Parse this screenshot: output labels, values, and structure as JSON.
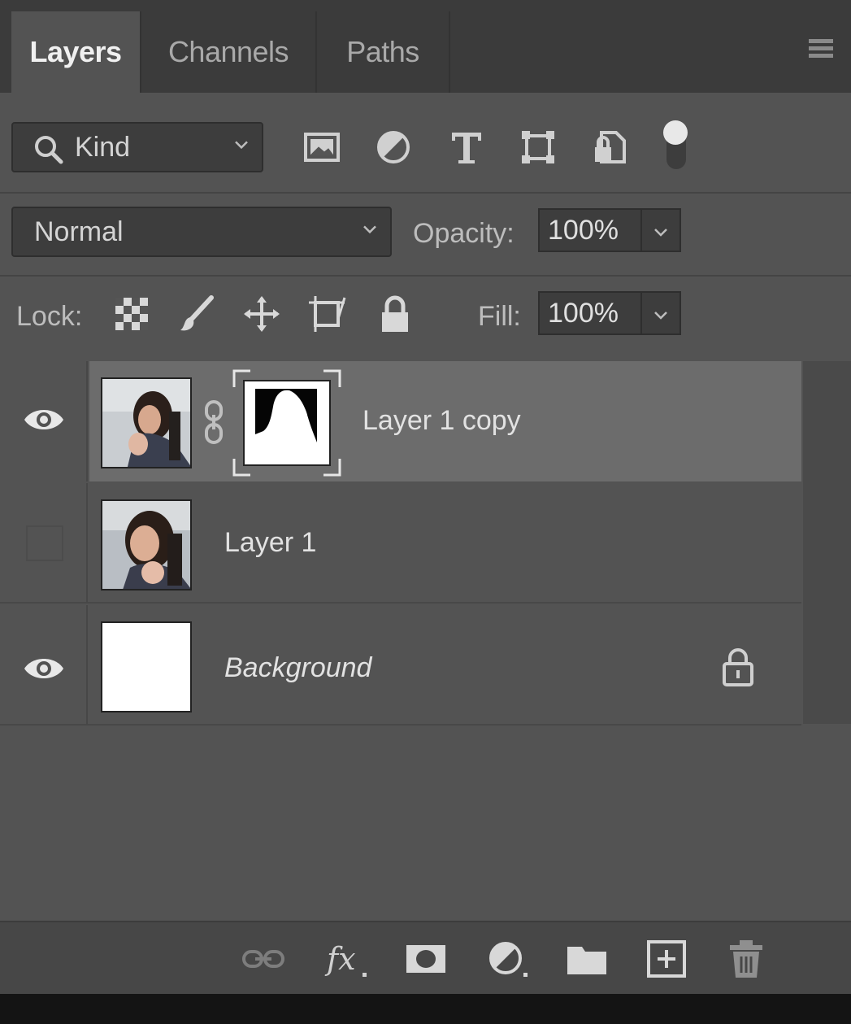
{
  "panel": {
    "tabs": [
      {
        "label": "Layers",
        "active": true
      },
      {
        "label": "Channels",
        "active": false
      },
      {
        "label": "Paths",
        "active": false
      }
    ],
    "menu_icon": "panel-menu-icon"
  },
  "filter": {
    "kind_label": "Kind",
    "search_icon": "search-icon",
    "filter_icons": [
      "image-filter-icon",
      "adjustment-filter-icon",
      "type-filter-icon",
      "shape-filter-icon",
      "smart-object-filter-icon"
    ],
    "toggle_icon": "filter-toggle-icon"
  },
  "blend": {
    "mode": "Normal",
    "opacity_label": "Opacity:",
    "opacity_value": "100%"
  },
  "lock": {
    "label": "Lock:",
    "icons": [
      "lock-transparent-pixels-icon",
      "lock-image-pixels-icon",
      "lock-position-icon",
      "lock-artboard-icon",
      "lock-all-icon"
    ],
    "fill_label": "Fill:",
    "fill_value": "100%"
  },
  "layers": [
    {
      "name": "Layer 1 copy",
      "visible": true,
      "selected": true,
      "has_mask": true,
      "italic": false,
      "locked": false
    },
    {
      "name": "Layer 1",
      "visible": false,
      "selected": false,
      "has_mask": false,
      "italic": false,
      "locked": false
    },
    {
      "name": "Background",
      "visible": true,
      "selected": false,
      "has_mask": false,
      "italic": true,
      "locked": true
    }
  ],
  "bottom_icons": [
    "link-layers-icon",
    "fx-icon",
    "add-mask-icon",
    "adjustment-layer-icon",
    "new-group-icon",
    "new-layer-icon",
    "delete-icon"
  ],
  "colors": {
    "panel_bg": "#535353",
    "tabbar_bg": "#3b3b3b",
    "selected_row": "#6c6c6c",
    "field_bg": "#3d3d3d"
  }
}
